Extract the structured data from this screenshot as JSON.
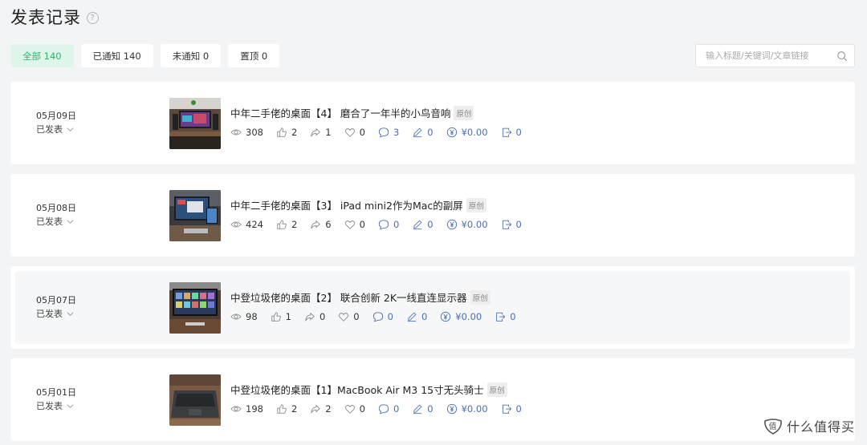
{
  "page": {
    "title": "发表记录"
  },
  "filters": [
    {
      "label": "全部 140"
    },
    {
      "label": "已通知 140"
    },
    {
      "label": "未通知 0"
    },
    {
      "label": "置顶 0"
    }
  ],
  "search": {
    "placeholder": "输入标题/关键词/文章链接"
  },
  "posts": [
    {
      "date": "05月09日",
      "status": "已发表",
      "title": "中年二手佬的桌面【4】 磨合了一年半的小鸟音响",
      "badge": "原创",
      "views": "308",
      "likes": "2",
      "shares": "1",
      "favorites": "0",
      "comments": "3",
      "edits": "0",
      "reward": "¥0.00",
      "exports": "0"
    },
    {
      "date": "05月08日",
      "status": "已发表",
      "title": "中年二手佬的桌面【3】 iPad mini2作为Mac的副屏",
      "badge": "原创",
      "views": "424",
      "likes": "2",
      "shares": "6",
      "favorites": "0",
      "comments": "0",
      "edits": "0",
      "reward": "¥0.00",
      "exports": "0"
    },
    {
      "date": "05月07日",
      "status": "已发表",
      "title": "中登垃圾佬的桌面【2】 联合创新 2K一线直连显示器",
      "badge": "原创",
      "views": "98",
      "likes": "1",
      "shares": "0",
      "favorites": "0",
      "comments": "0",
      "edits": "0",
      "reward": "¥0.00",
      "exports": "0"
    },
    {
      "date": "05月01日",
      "status": "已发表",
      "title": "中登垃圾佬的桌面【1】MacBook Air M3 15寸无头骑士",
      "badge": "原创",
      "views": "198",
      "likes": "2",
      "shares": "2",
      "favorites": "0",
      "comments": "0",
      "edits": "0",
      "reward": "¥0.00",
      "exports": "0"
    }
  ],
  "watermark": {
    "text": "什么值得买"
  },
  "colors": {
    "accent": "#2fb36f",
    "accent_bg": "#dff5ea",
    "stat_blue": "#4a6fb5",
    "page_bg": "#f3f4f6"
  }
}
